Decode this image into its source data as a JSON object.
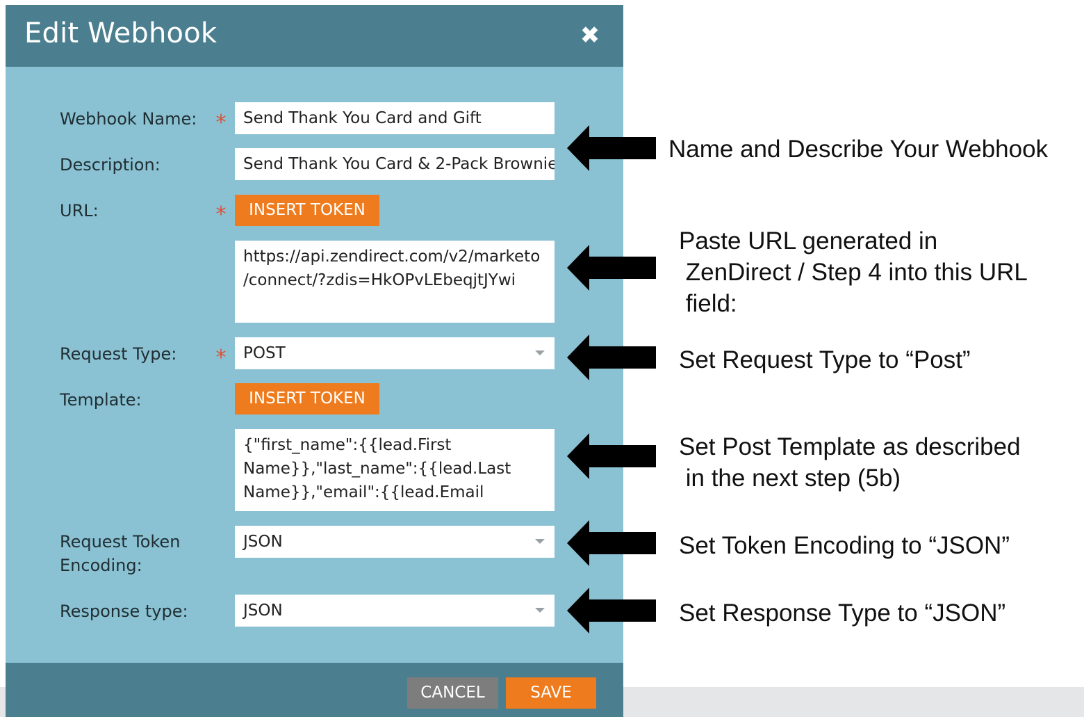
{
  "dialog": {
    "title": "Edit Webhook",
    "fields": {
      "webhook_name": {
        "label": "Webhook Name:",
        "value": "Send Thank You Card and Gift"
      },
      "description": {
        "label": "Description:",
        "value": "Send Thank You Card & 2-Pack Brownie"
      },
      "url": {
        "label": "URL:",
        "token_button": "INSERT TOKEN",
        "value": "https://api.zendirect.com/v2/marketo\n/connect/?zdis=HkOPvLEbeqjtJYwi"
      },
      "request_type": {
        "label": "Request Type:",
        "value": "POST"
      },
      "template": {
        "label": "Template:",
        "token_button": "INSERT TOKEN",
        "value": "{\"first_name\":{{lead.First\nName}},\"last_name\":{{lead.Last\nName}},\"email\":{{lead.Email"
      },
      "request_token_encoding": {
        "label_line1": "Request Token",
        "label_line2": "Encoding:",
        "value": "JSON"
      },
      "response_type": {
        "label": "Response type:",
        "value": "JSON"
      }
    },
    "footer": {
      "cancel_label": "CANCEL",
      "save_label": "SAVE"
    }
  },
  "annotations": {
    "name_describe": "Name and Describe Your Webhook",
    "paste_url": "Paste URL generated in\n ZenDirect / Step 4 into this URL\n field:",
    "request_type": "Set Request Type to “Post”",
    "post_template": "Set Post Template as described\n in the next step (5b)",
    "token_encoding": "Set Token Encoding to “JSON”",
    "response_type": "Set Response Type to “JSON”"
  },
  "colors": {
    "dialog_body": "#8bc2d3",
    "dialog_header": "#4b7f90",
    "accent_orange": "#ee7b1d",
    "cancel_gray": "#7d7d7d",
    "required_star": "#d9523a"
  },
  "icons": {
    "close": "close-icon",
    "required": "required-asterisk-icon",
    "dropdown": "chevron-down-icon",
    "pointer": "arrow-left-icon"
  }
}
